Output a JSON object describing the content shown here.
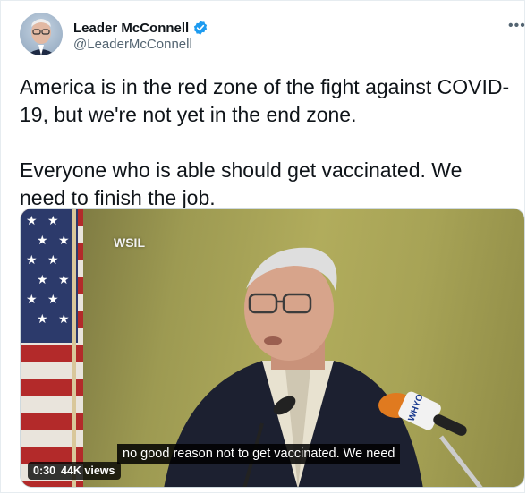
{
  "author": {
    "name": "Leader McConnell",
    "handle": "@LeaderMcConnell"
  },
  "tweet": {
    "paragraph_1": "America is in the red zone of the fight against COVID-19, but we're not yet in the end zone.",
    "paragraph_2": "Everyone who is able should get vaccinated. We need to finish the job."
  },
  "video": {
    "watermark": "WSIL",
    "caption": "no good reason not to get vaccinated. We need",
    "time": "0:30",
    "views": "44K views",
    "mic_label": "WHYO"
  },
  "icons": {
    "more": "more-options-icon",
    "verified": "verified-badge-icon"
  },
  "colors": {
    "verified_blue": "#1d9bf0",
    "text_primary": "#0f1419",
    "text_secondary": "#536471"
  }
}
